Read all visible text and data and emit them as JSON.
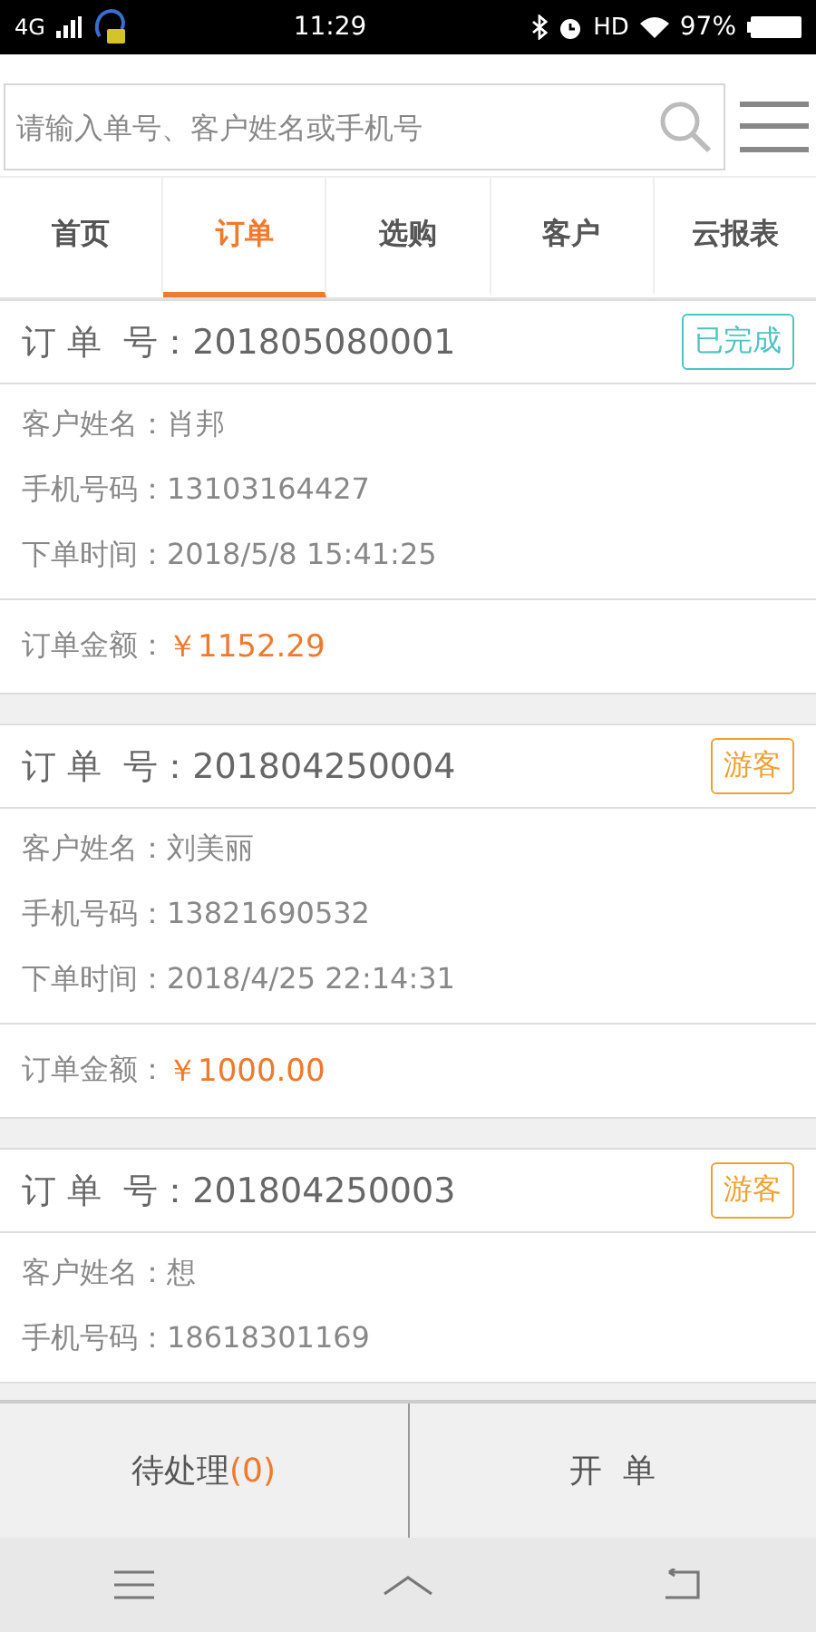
{
  "status_bar": {
    "network": "4G",
    "time": "11:29",
    "hd": "HD",
    "battery": "97%"
  },
  "search": {
    "placeholder": "请输入单号、客户姓名或手机号"
  },
  "tabs": [
    {
      "label": "首页",
      "selected": false
    },
    {
      "label": "订单",
      "selected": true
    },
    {
      "label": "选购",
      "selected": false
    },
    {
      "label": "客户",
      "selected": false
    },
    {
      "label": "云报表",
      "selected": false
    }
  ],
  "orders": [
    {
      "number_label": "订 单  号：",
      "number": "201805080001",
      "badge": {
        "label": "已完成",
        "color": "#4cc3c3"
      },
      "fields": [
        {
          "label": "客户姓名：",
          "value": "肖邦"
        },
        {
          "label": "手机号码：",
          "value": "13103164427"
        },
        {
          "label": "下单时间：",
          "value": "2018/5/8 15:41:25"
        }
      ],
      "amount_label": "订单金额：",
      "amount": "￥1152.29"
    },
    {
      "number_label": "订 单  号：",
      "number": "201804250004",
      "badge": {
        "label": "游客",
        "color": "#f0a030"
      },
      "fields": [
        {
          "label": "客户姓名：",
          "value": "刘美丽"
        },
        {
          "label": "手机号码：",
          "value": "13821690532"
        },
        {
          "label": "下单时间：",
          "value": "2018/4/25 22:14:31"
        }
      ],
      "amount_label": "订单金额：",
      "amount": "￥1000.00"
    },
    {
      "number_label": "订 单  号：",
      "number": "201804250003",
      "badge": {
        "label": "游客",
        "color": "#f0a030"
      },
      "fields": [
        {
          "label": "客户姓名：",
          "value": "想"
        },
        {
          "label": "手机号码：",
          "value": "18618301169"
        }
      ]
    }
  ],
  "bottom_bar": {
    "pending_label": "待处理",
    "pending_count": "(0)",
    "new_order": "开  单"
  }
}
